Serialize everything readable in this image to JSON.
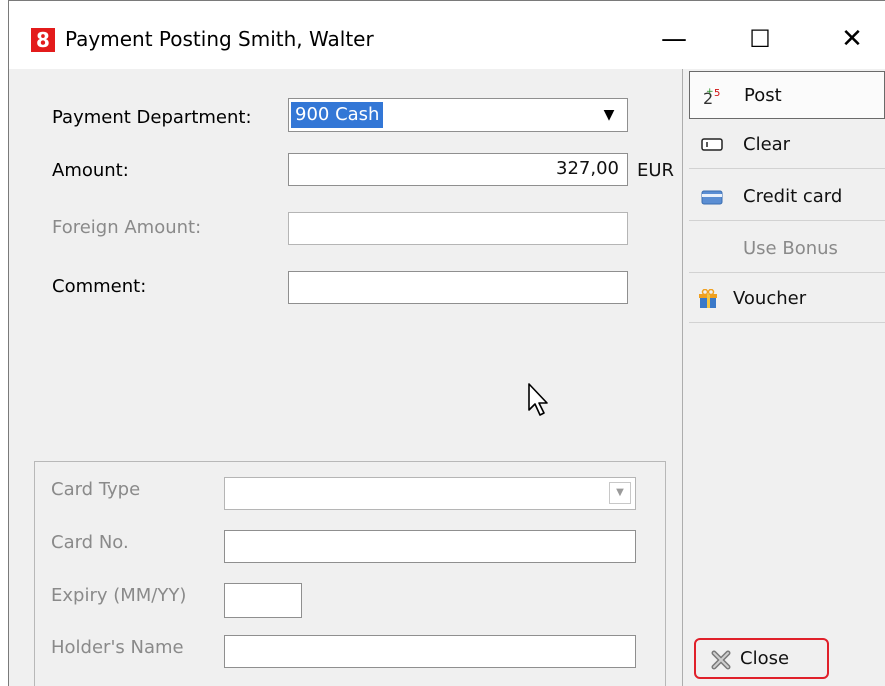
{
  "window": {
    "icon_glyph": "8",
    "title": "Payment Posting Smith, Walter",
    "minimize_glyph": "—",
    "maximize_glyph": "☐",
    "close_glyph": "✕"
  },
  "form": {
    "payment_department": {
      "label": "Payment Department:",
      "value": "900   Cash"
    },
    "amount": {
      "label": "Amount:",
      "value": "327,00",
      "currency": "EUR"
    },
    "foreign_amount": {
      "label": "Foreign Amount:",
      "value": ""
    },
    "comment": {
      "label": "Comment:",
      "value": ""
    }
  },
  "card": {
    "card_type_label": "Card Type",
    "card_no_label": "Card No.",
    "expiry_label": "Expiry (MM/YY)",
    "holder_label": "Holder's Name"
  },
  "sidebar": {
    "post": "Post",
    "clear": "Clear",
    "credit_card": "Credit card",
    "use_bonus": "Use Bonus",
    "voucher": "Voucher",
    "close": "Close"
  },
  "colors": {
    "accent": "#3377d6",
    "highlight_border": "#e0202a",
    "app_icon": "#e31b1b"
  }
}
